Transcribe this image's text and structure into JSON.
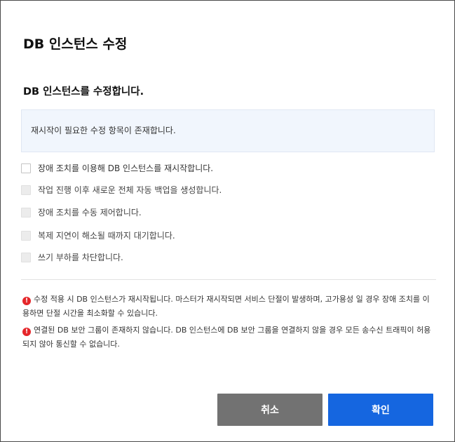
{
  "dialog": {
    "title": "DB 인스턴스 수정",
    "subtitle": "DB 인스턴스를 수정합니다.",
    "info": "재시작이 필요한 수정 항목이 존재합니다."
  },
  "options": [
    {
      "label": "장애 조치를 이용해 DB 인스턴스를 재시작합니다.",
      "checked": false,
      "disabled": false
    },
    {
      "label": "작업 진행 이후 새로운 전체 자동 백업을 생성합니다.",
      "checked": false,
      "disabled": true
    },
    {
      "label": "장애 조치를 수동 제어합니다.",
      "checked": false,
      "disabled": true
    },
    {
      "label": "복제 지연이 해소될 때까지 대기합니다.",
      "checked": false,
      "disabled": true
    },
    {
      "label": "쓰기 부하를 차단합니다.",
      "checked": false,
      "disabled": true
    }
  ],
  "warnings": [
    {
      "icon": "!",
      "text": "수정 적용 시 DB 인스턴스가 재시작됩니다. 마스터가 재시작되면 서비스 단절이 발생하며, 고가용성 일 경우 장애 조치를 이용하면 단절 시간을 최소화할 수 있습니다."
    },
    {
      "icon": "!",
      "text": "연결된 DB 보안 그룹이 존재하지 않습니다. DB 인스턴스에 DB 보안 그룹을 연결하지 않을 경우 모든 송수신 트래픽이 허용되지 않아 통신할 수 없습니다."
    }
  ],
  "buttons": {
    "cancel": "취소",
    "confirm": "확인"
  },
  "colors": {
    "info_background": "#f1f6fd",
    "warning_icon": "#e5262a",
    "cancel_button": "#727272",
    "confirm_button": "#1566e0"
  }
}
